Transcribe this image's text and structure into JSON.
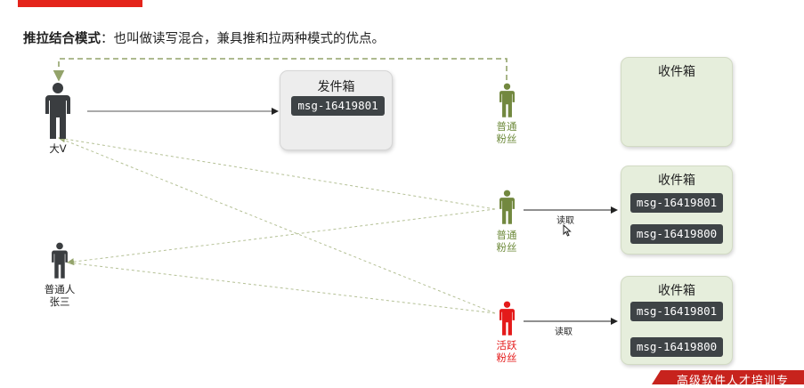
{
  "heading": {
    "bold": "推拉结合模式",
    "rest": "：也叫做读写混合，兼具推和拉两种模式的优点。"
  },
  "outbox": {
    "title": "发件箱",
    "msg": "msg-16419801"
  },
  "inboxes": [
    {
      "title": "收件箱",
      "msgs": []
    },
    {
      "title": "收件箱",
      "msgs": [
        "msg-16419801",
        "msg-16419800"
      ]
    },
    {
      "title": "收件箱",
      "msgs": [
        "msg-16419801",
        "msg-16419800"
      ]
    }
  ],
  "people": {
    "big_v": "大V",
    "normal_user_line1": "普通人",
    "normal_user_line2": "张三",
    "fan_top_line1": "普通",
    "fan_top_line2": "粉丝",
    "fan_mid_line1": "普通",
    "fan_mid_line2": "粉丝",
    "active_fan_line1": "活跃",
    "active_fan_line2": "粉丝"
  },
  "read_label_1": "读取",
  "read_label_2": "读取",
  "footer_text": "高级软件人才培训专",
  "colors": {
    "dark_figure": "#3a3d40",
    "green_figure": "#72883f",
    "red_figure": "#e41a1a",
    "dashed_line": "#93a36a",
    "green_text": "#6d8a3a",
    "red_text": "#e41a1a"
  }
}
